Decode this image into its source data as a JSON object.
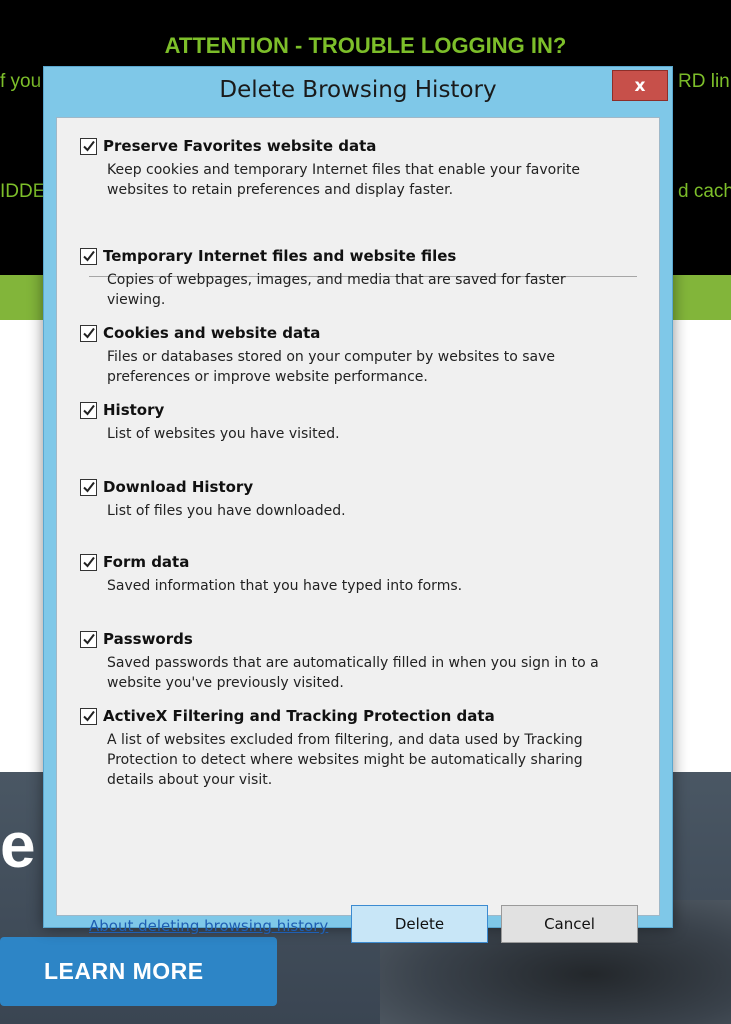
{
  "background": {
    "banner_text": "ATTENTION - TROUBLE LOGGING IN?",
    "fragment_left_1": "f you",
    "fragment_left_2": "IDDE",
    "fragment_right_1": "RD lin",
    "fragment_right_2": "d cach",
    "hero_letter": "e",
    "learn_more": "LEARN MORE"
  },
  "dialog": {
    "title": "Delete Browsing History",
    "close_label": "x",
    "items": [
      {
        "label": "Preserve Favorites website data",
        "desc": "Keep cookies and temporary Internet files that enable your favorite websites to retain preferences and display faster.",
        "checked": true
      },
      {
        "label": "Temporary Internet files and website files",
        "desc": "Copies of webpages, images, and media that are saved for faster viewing.",
        "checked": true
      },
      {
        "label": "Cookies and website data",
        "desc": "Files or databases stored on your computer by websites to save preferences or improve website performance.",
        "checked": true
      },
      {
        "label": "History",
        "desc": "List of websites you have visited.",
        "checked": true
      },
      {
        "label": "Download History",
        "desc": "List of files you have downloaded.",
        "checked": true
      },
      {
        "label": "Form data",
        "desc": "Saved information that you have typed into forms.",
        "checked": true
      },
      {
        "label": "Passwords",
        "desc": "Saved passwords that are automatically filled in when you sign in to a website you've previously visited.",
        "checked": true
      },
      {
        "label": "ActiveX Filtering and Tracking Protection data",
        "desc": "A list of websites excluded from filtering, and data used by Tracking Protection to detect where websites might be automatically sharing details about your visit.",
        "checked": true
      }
    ],
    "about_link": "About deleting browsing history",
    "delete_label": "Delete",
    "cancel_label": "Cancel"
  }
}
